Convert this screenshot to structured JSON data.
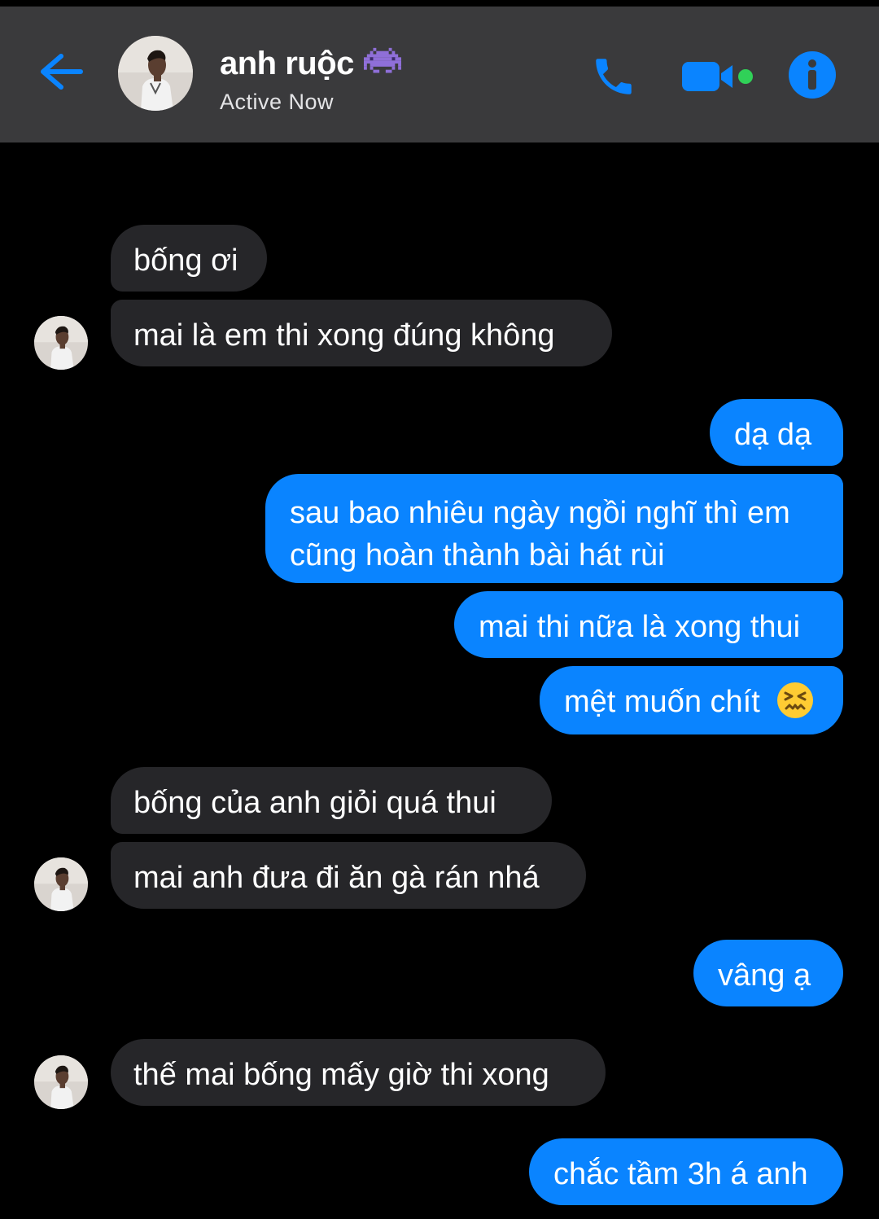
{
  "header": {
    "contact_name": "anh ruộc",
    "status": "Active Now",
    "name_emoji": "alien-monster-emoji",
    "back_icon": "arrow-left-icon",
    "call_icon": "phone-icon",
    "video_icon": "video-camera-icon",
    "info_icon": "info-icon",
    "accent_color": "#0a84ff",
    "online_color": "#30d158"
  },
  "messages": [
    {
      "side": "received",
      "text": "bống ơi"
    },
    {
      "side": "received",
      "text": "mai là em thi xong đúng không"
    },
    {
      "side": "sent",
      "text": "dạ dạ"
    },
    {
      "side": "sent",
      "line1": "sau bao nhiêu ngày ngồi nghĩ thì em",
      "line2": "cũng hoàn thành bài hát rùi"
    },
    {
      "side": "sent",
      "text": "mai thi nữa là xong thui"
    },
    {
      "side": "sent",
      "text": "mệt muốn chít",
      "emoji": "confounded-face-emoji"
    },
    {
      "side": "received",
      "text": "bống của anh giỏi quá thui"
    },
    {
      "side": "received",
      "text": "mai anh đưa đi ăn gà rán nhá"
    },
    {
      "side": "sent",
      "text": "vâng ạ"
    },
    {
      "side": "received",
      "text": "thế mai bống mấy giờ thi xong"
    },
    {
      "side": "sent",
      "text": "chắc tầm 3h á anh"
    }
  ]
}
